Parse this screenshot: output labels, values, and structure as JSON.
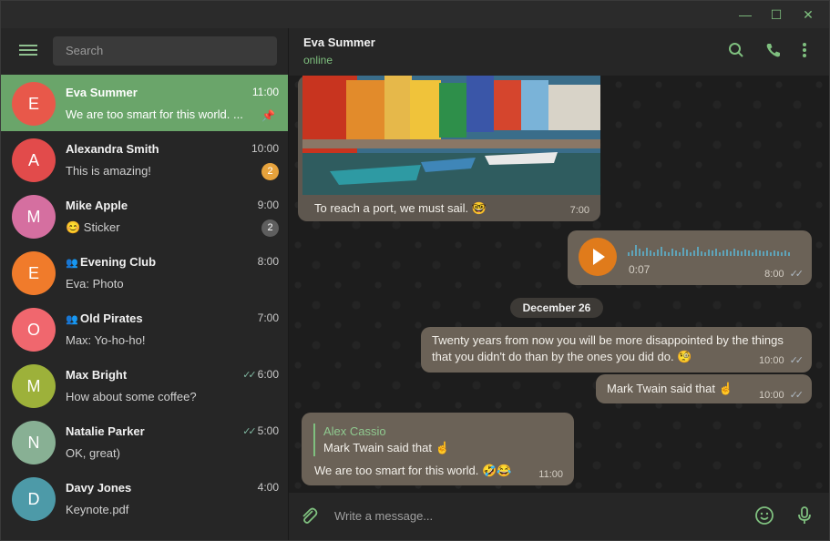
{
  "window": {
    "minimize": "—",
    "maximize": "☐",
    "close": "✕"
  },
  "search": {
    "placeholder": "Search"
  },
  "chats": [
    {
      "initial": "E",
      "name": "Eva Summer",
      "time": "11:00",
      "message": "We are too smart for this world. ...",
      "color": "#e8584a",
      "active": true,
      "pinned": true
    },
    {
      "initial": "A",
      "name": "Alexandra Smith",
      "time": "10:00",
      "message": "This is amazing!",
      "color": "#e24b4b",
      "badge": "2",
      "badge_color": "#e6a23c"
    },
    {
      "initial": "M",
      "name": "Mike Apple",
      "time": "9:00",
      "message": "😊 Sticker",
      "color": "#d56fa0",
      "badge": "2",
      "badge_color": "#5e5e5e"
    },
    {
      "initial": "E",
      "name": "Evening Club",
      "time": "8:00",
      "message": "Eva: Photo",
      "color": "#f07b2b",
      "group": true
    },
    {
      "initial": "O",
      "name": "Old Pirates",
      "time": "7:00",
      "message": "Max: Yo-ho-ho!",
      "color": "#f0676e",
      "group": true
    },
    {
      "initial": "M",
      "name": "Max Bright",
      "time": "6:00",
      "message": "How about some coffee?",
      "color": "#9db13a",
      "read": true
    },
    {
      "initial": "N",
      "name": "Natalie Parker",
      "time": "5:00",
      "message": "OK, great)",
      "color": "#88b094",
      "read": true
    },
    {
      "initial": "D",
      "name": "Davy Jones",
      "time": "4:00",
      "message": "Keynote.pdf",
      "color": "#4d9aa8"
    }
  ],
  "chat": {
    "name": "Eva Summer",
    "status": "online",
    "photo_caption": "To reach a port, we must sail. 🤓",
    "photo_time": "7:00",
    "voice_duration": "0:07",
    "voice_time": "8:00",
    "date_separator": "December 26",
    "quote": "Twenty years from now you will be more disappointed by the things that you didn't do than by the ones you did do. 🧐",
    "quote_time": "10:00",
    "twain": "Mark Twain said that ☝",
    "twain_time": "10:00",
    "reply_author": "Alex Cassio",
    "reply_text": "Mark Twain said that ☝",
    "last_message": "We are too smart for this world. 🤣😂",
    "last_time": "11:00",
    "composer_placeholder": "Write a message..."
  },
  "icons": {
    "search": "search-icon",
    "call": "phone-icon",
    "more": "more-vertical-icon",
    "attach": "paperclip-icon",
    "emoji": "emoji-icon",
    "mic": "microphone-icon"
  },
  "accent": "#7fc07f"
}
